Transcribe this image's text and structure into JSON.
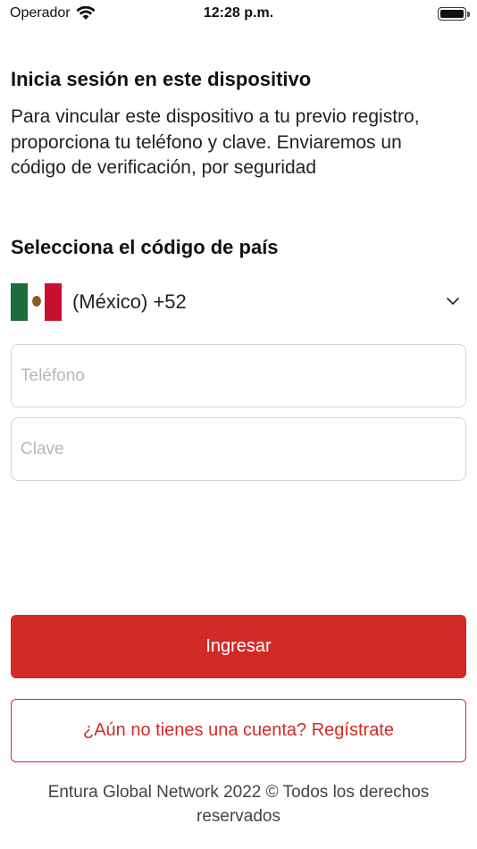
{
  "status_bar": {
    "carrier": "Operador",
    "time": "12:28 p.m."
  },
  "login": {
    "title": "Inicia sesión en este dispositivo",
    "description": "Para vincular este dispositivo a tu previo registro, proporciona tu teléfono y clave. Enviaremos un código de verificación, por seguridad"
  },
  "country": {
    "title": "Selecciona el código de país",
    "selected": "(México) +52",
    "flag_icon": "mexico-flag-icon"
  },
  "form": {
    "phone_placeholder": "Teléfono",
    "phone_value": "",
    "password_placeholder": "Clave",
    "password_value": ""
  },
  "actions": {
    "login_label": "Ingresar",
    "register_label": "¿Aún no tienes una cuenta? Regístrate"
  },
  "footer": {
    "text": "Entura Global Network 2022 © Todos los derechos reservados"
  },
  "colors": {
    "accent": "#d12b27",
    "border": "#d4d4d4",
    "placeholder": "#b8b8b8"
  }
}
